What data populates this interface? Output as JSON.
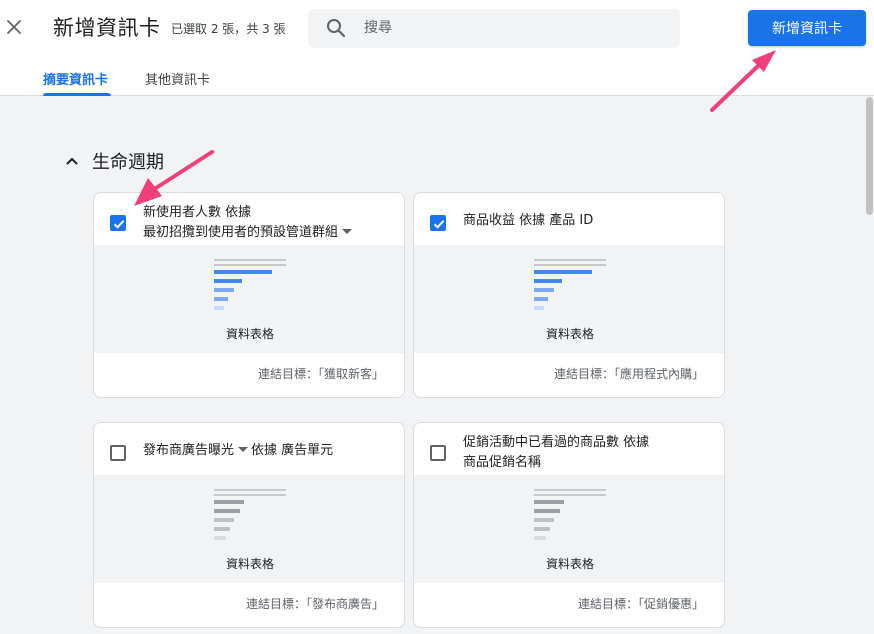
{
  "header": {
    "title": "新增資訊卡",
    "subtitle": "已選取 2 張，共 3 張",
    "search_placeholder": "搜尋",
    "add_button_label": "新增資訊卡"
  },
  "tabs": [
    {
      "label": "摘要資訊卡",
      "active": true
    },
    {
      "label": "其他資訊卡",
      "active": false
    }
  ],
  "section": {
    "title": "生命週期",
    "expanded": true
  },
  "cards": [
    {
      "checked": true,
      "title_line1": "新使用者人數 依據",
      "title_line2": "最初招攬到使用者的預設管道群組",
      "has_dropdown": true,
      "preview_label": "資料表格",
      "goal": "連結目標：「獲取新客」",
      "preview_accent": "#4285f4"
    },
    {
      "checked": true,
      "title_line1": "商品收益 依據 產品 ID",
      "title_line2": "",
      "has_dropdown": false,
      "preview_label": "資料表格",
      "goal": "連結目標：「應用程式內購」",
      "preview_accent": "#4285f4"
    },
    {
      "checked": false,
      "title_pre": "發布商廣告曝光",
      "title_post": "依據 廣告單元",
      "has_dropdown": true,
      "preview_label": "資料表格",
      "goal": "連結目標：「發布商廣告」",
      "preview_accent": "#9aa0a6"
    },
    {
      "checked": false,
      "title_line1": "促銷活動中已看過的商品數 依據",
      "title_line2": "商品促銷名稱",
      "has_dropdown": false,
      "preview_label": "資料表格",
      "goal": "連結目標：「促銷優惠」",
      "preview_accent": "#9aa0a6"
    }
  ],
  "icons": {
    "close": "close-icon",
    "search": "search-icon",
    "chevron": "chevron-up-icon",
    "checkbox_checked": "checkbox-checked-icon",
    "checkbox_unchecked": "checkbox-unchecked-icon",
    "dropdown": "caret-down-icon",
    "table_preview": "table-preview-icon"
  },
  "colors": {
    "accent": "#1a73e8",
    "annotation_arrow": "#f0407a",
    "background": "#f1f3f4"
  }
}
